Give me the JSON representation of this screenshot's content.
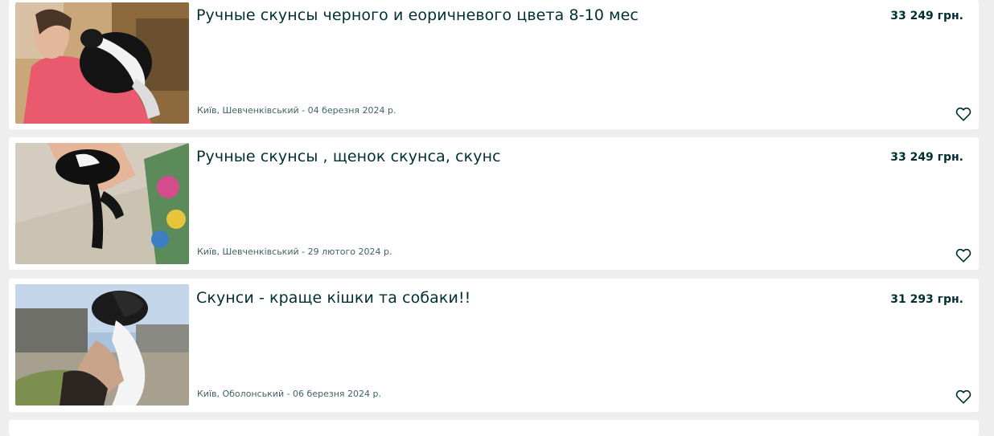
{
  "listings": [
    {
      "title": "Ручные скунсы черного и еоричневого цвета 8-10 мес",
      "price": "33 249 грн.",
      "location": "Київ, Шевченківський - 04 березня 2024 р.",
      "favorite_icon": "heart-outline-icon"
    },
    {
      "title": "Ручные скунсы , щенок скунса, скунс",
      "price": "33 249 грн.",
      "location": "Київ, Шевченківський - 29 лютого 2024 р.",
      "favorite_icon": "heart-outline-icon"
    },
    {
      "title": "Скунси - краще кішки та собаки!!",
      "price": "31 293 грн.",
      "location": "Київ, Оболонський - 06 березня 2024 р.",
      "favorite_icon": "heart-outline-icon"
    }
  ],
  "colors": {
    "page_background": "#eeeeee",
    "card_background": "#ffffff",
    "text_primary": "#002f34",
    "text_secondary": "#406367"
  }
}
